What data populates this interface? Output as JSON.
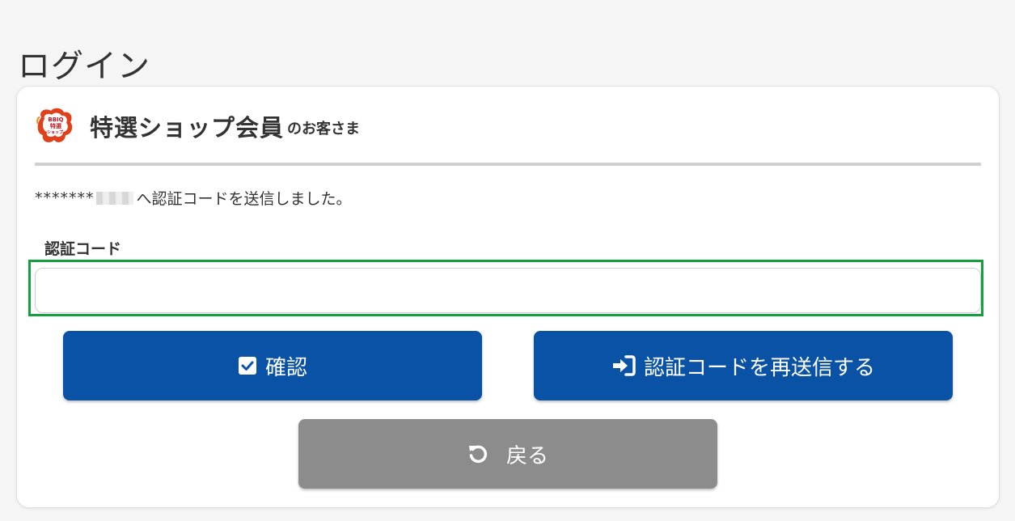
{
  "page": {
    "title": "ログイン"
  },
  "brand": {
    "title": "特選ショップ会員",
    "suffix": "のお客さま",
    "logo_text": "BBIQ 特選 ショップ"
  },
  "message": {
    "masked_address": "*******",
    "text": "へ認証コードを送信しました。"
  },
  "form": {
    "label": "認証コード",
    "value": "",
    "placeholder": ""
  },
  "buttons": {
    "confirm": "確認",
    "resend": "認証コードを再送信する",
    "back": "戻る"
  },
  "icons": {
    "confirm": "check-square-icon",
    "resend": "sign-in-icon",
    "back": "undo-icon"
  },
  "colors": {
    "primary": "#0a52a5",
    "secondary": "#8c8c8c",
    "highlight": "#14a03c",
    "logo_red": "#e0401c",
    "logo_orange": "#f08a24"
  }
}
